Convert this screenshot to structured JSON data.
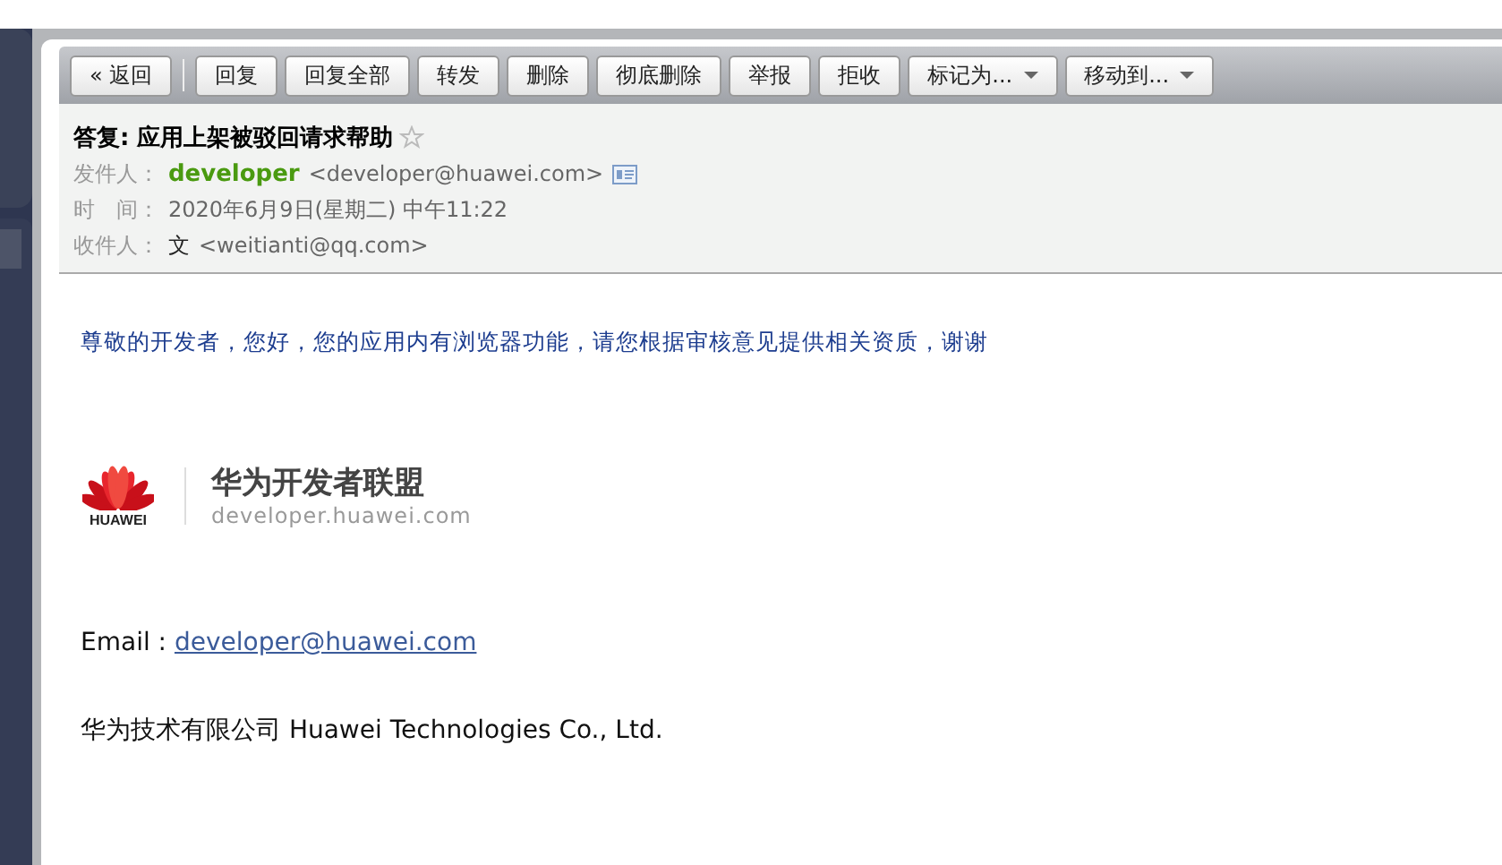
{
  "toolbar": {
    "back": "« 返回",
    "buttons": [
      {
        "label": "回复",
        "kind": "plain"
      },
      {
        "label": "回复全部",
        "kind": "plain"
      },
      {
        "label": "转发",
        "kind": "plain"
      },
      {
        "label": "删除",
        "kind": "plain"
      },
      {
        "label": "彻底删除",
        "kind": "plain"
      },
      {
        "label": "举报",
        "kind": "plain"
      },
      {
        "label": "拒收",
        "kind": "plain"
      },
      {
        "label": "标记为...",
        "kind": "menu"
      },
      {
        "label": "移动到...",
        "kind": "menu"
      }
    ]
  },
  "header": {
    "subject": "答复: 应用上架被驳回请求帮助",
    "starred": false,
    "fields": [
      {
        "label": "发件人：",
        "kind": "sender",
        "name": "developer",
        "value": "<developer@huawei.com>"
      },
      {
        "label": "时　间：",
        "kind": "time",
        "value": "2020年6月9日(星期二) 中午11:22"
      },
      {
        "label": "收件人：",
        "kind": "recipient",
        "name": "文",
        "value": "<weitianti@qq.com>"
      }
    ]
  },
  "body": {
    "greeting": "尊敬的开发者，您好，您的应用内有浏览器功能，请您根据审核意见提供相关资质，谢谢",
    "logo": {
      "brand": "HUAWEI",
      "title": "华为开发者联盟",
      "url": "developer.huawei.com"
    },
    "email_label": "Email : ",
    "email": "developer@huawei.com",
    "company": "华为技术有限公司 Huawei Technologies Co., Ltd."
  }
}
